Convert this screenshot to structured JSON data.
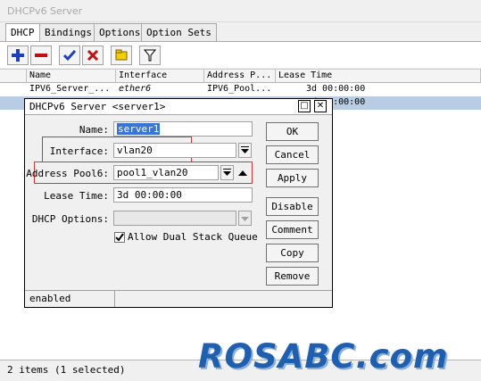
{
  "window": {
    "title": "DHCPv6 Server"
  },
  "tabs": [
    "DHCP",
    "Bindings",
    "Options",
    "Option Sets"
  ],
  "toolbar": {
    "icons": [
      "add-icon",
      "remove-icon",
      "enable-icon",
      "disable-icon",
      "comment-icon",
      "filter-icon"
    ],
    "colors": {
      "add": "#1a3fbf",
      "remove": "#c01010",
      "enable": "#1a3fbf",
      "disable": "#c01010",
      "comment": "#f0d000"
    }
  },
  "grid": {
    "columns": [
      "Name",
      "Interface",
      "Address P...",
      "Lease Time"
    ],
    "rows": [
      {
        "name": "IPV6_Server_...",
        "interface": "ether6",
        "address_pool": "IPV6_Pool...",
        "lease_time": "3d 00:00:00",
        "selected": false
      },
      {
        "name": "",
        "interface": "",
        "address_pool": "",
        "lease_time": "3d 00:00:00",
        "selected": true
      }
    ]
  },
  "status": {
    "text": "2 items (1 selected)"
  },
  "watermark": "ROSABC.com",
  "dialog": {
    "title": "DHCPv6 Server <server1>",
    "labels": {
      "name": "Name:",
      "interface": "Interface:",
      "address_pool6": "Address Pool6:",
      "lease_time": "Lease Time:",
      "dhcp_options": "DHCP Options:",
      "allow_dual_stack": "Allow Dual Stack Queue"
    },
    "values": {
      "name": "server1",
      "interface": "vlan20",
      "address_pool6": "pool1_vlan20",
      "lease_time": "3d 00:00:00",
      "dhcp_options": "",
      "allow_dual_stack": true
    },
    "buttons": [
      "OK",
      "Cancel",
      "Apply",
      "Disable",
      "Comment",
      "Copy",
      "Remove"
    ],
    "status": "enabled",
    "highlight_color": "#e03030"
  }
}
